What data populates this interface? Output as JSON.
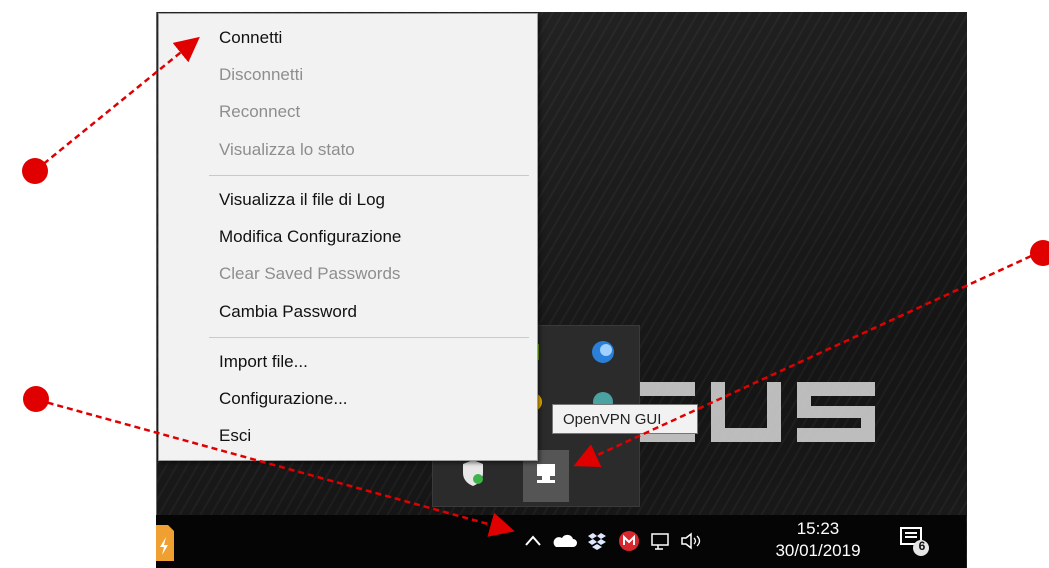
{
  "context_menu": {
    "items": [
      {
        "label": "Connetti",
        "enabled": true
      },
      {
        "label": "Disconnetti",
        "enabled": false
      },
      {
        "label": "Reconnect",
        "enabled": false
      },
      {
        "label": "Visualizza lo stato",
        "enabled": false
      },
      {
        "label": "Visualizza il file di Log",
        "enabled": true
      },
      {
        "label": "Modifica Configurazione",
        "enabled": true
      },
      {
        "label": "Clear Saved Passwords",
        "enabled": false
      },
      {
        "label": "Cambia Password",
        "enabled": true
      },
      {
        "label": "Import file...",
        "enabled": true
      },
      {
        "label": "Configurazione...",
        "enabled": true
      },
      {
        "label": "Esci",
        "enabled": true
      }
    ]
  },
  "tooltip": {
    "text": "OpenVPN GUI"
  },
  "taskbar": {
    "time": "15:23",
    "date": "30/01/2019",
    "notification_count": "6"
  },
  "icons": {
    "tray": [
      "chevron-up-icon",
      "onedrive-icon",
      "dropbox-icon",
      "mega-icon",
      "network-icon",
      "volume-icon"
    ],
    "flyout": [
      "nvidia-icon",
      "blue-swirl-icon",
      "chrome-icon",
      "cloud-icon",
      "shield-icon",
      "openvpn-icon"
    ],
    "notification": "action-center-icon"
  },
  "colors": {
    "annotation": "#e00000",
    "menu_background": "#f2f2f2",
    "disabled_text": "#8e8e8e",
    "taskbar": "#050505"
  }
}
